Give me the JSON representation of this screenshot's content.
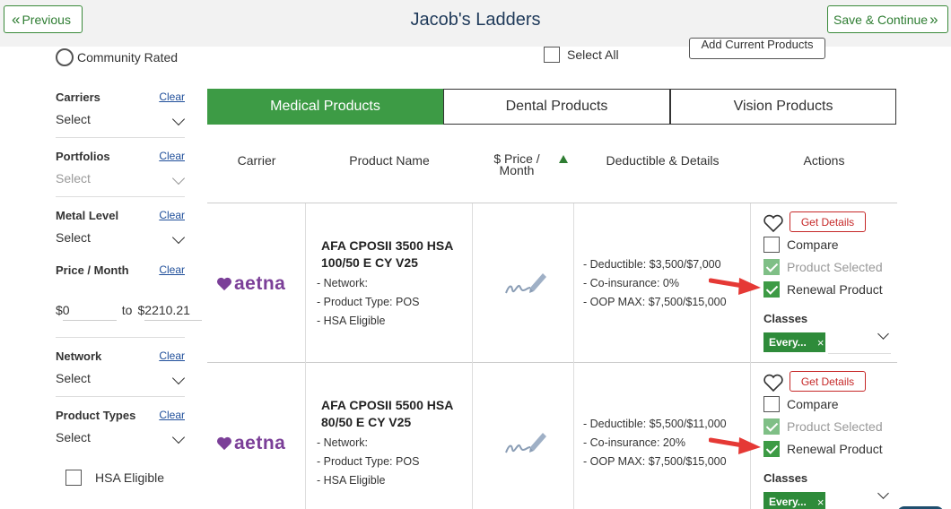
{
  "header": {
    "prev_label": "Previous",
    "title": "Jacob's Ladders",
    "next_label": "Save & Continue"
  },
  "sidebar": {
    "community_rated": "Community Rated",
    "filters": [
      {
        "label": "Carriers",
        "clear": "Clear",
        "value": "Select"
      },
      {
        "label": "Portfolios",
        "clear": "Clear",
        "value": "Select"
      },
      {
        "label": "Metal Level",
        "clear": "Clear",
        "value": "Select"
      },
      {
        "label": "Network",
        "clear": "Clear",
        "value": "Select"
      },
      {
        "label": "Product Types",
        "clear": "Clear",
        "value": "Select"
      }
    ],
    "price": {
      "label": "Price / Month",
      "clear": "Clear",
      "min": "0",
      "to": "to",
      "max": "2210.21",
      "currency": "$"
    },
    "hsa_eligible": "HSA Eligible"
  },
  "toolbar": {
    "select_all": "Select All",
    "add_current": "Add Current Products"
  },
  "tabs": [
    {
      "label": "Medical Products",
      "active": true
    },
    {
      "label": "Dental Products",
      "active": false
    },
    {
      "label": "Vision Products",
      "active": false
    }
  ],
  "table": {
    "columns": [
      "Carrier",
      "Product Name",
      "$ Price / Month",
      "Deductible & Details",
      "Actions"
    ],
    "price_col_line1": "$ Price /",
    "price_col_line2": "Month",
    "rows": [
      {
        "carrier": "aetna",
        "product_name": "AFA CPOSII 3500 HSA 100/50 E CY V25",
        "details": [
          "- Network:",
          "- Product Type: POS",
          "- HSA Eligible"
        ],
        "deductible": [
          "- Deductible: $3,500/$7,000",
          "- Co-insurance: 0%",
          "- OOP MAX: $7,500/$15,000"
        ],
        "get_details": "Get Details",
        "compare": "Compare",
        "product_selected": "Product Selected",
        "renewal_product": "Renewal Product",
        "classes_label": "Classes",
        "class_chip": "Every...",
        "chip_remove": "×"
      },
      {
        "carrier": "aetna",
        "product_name": "AFA CPOSII 5500 HSA 80/50 E CY V25",
        "details": [
          "- Network:",
          "- Product Type: POS",
          "- HSA Eligible"
        ],
        "deductible": [
          "- Deductible: $5,500/$11,000",
          "- Co-insurance: 20%",
          "- OOP MAX: $7,500/$15,000"
        ],
        "get_details": "Get Details",
        "compare": "Compare",
        "product_selected": "Product Selected",
        "renewal_product": "Renewal Product",
        "classes_label": "Classes",
        "class_chip": "Every...",
        "chip_remove": "×"
      }
    ]
  },
  "colors": {
    "accent_green": "#3d9b45",
    "aetna_purple": "#7b3f98",
    "danger_red": "#c62828",
    "title_navy": "#1f3a5a"
  }
}
